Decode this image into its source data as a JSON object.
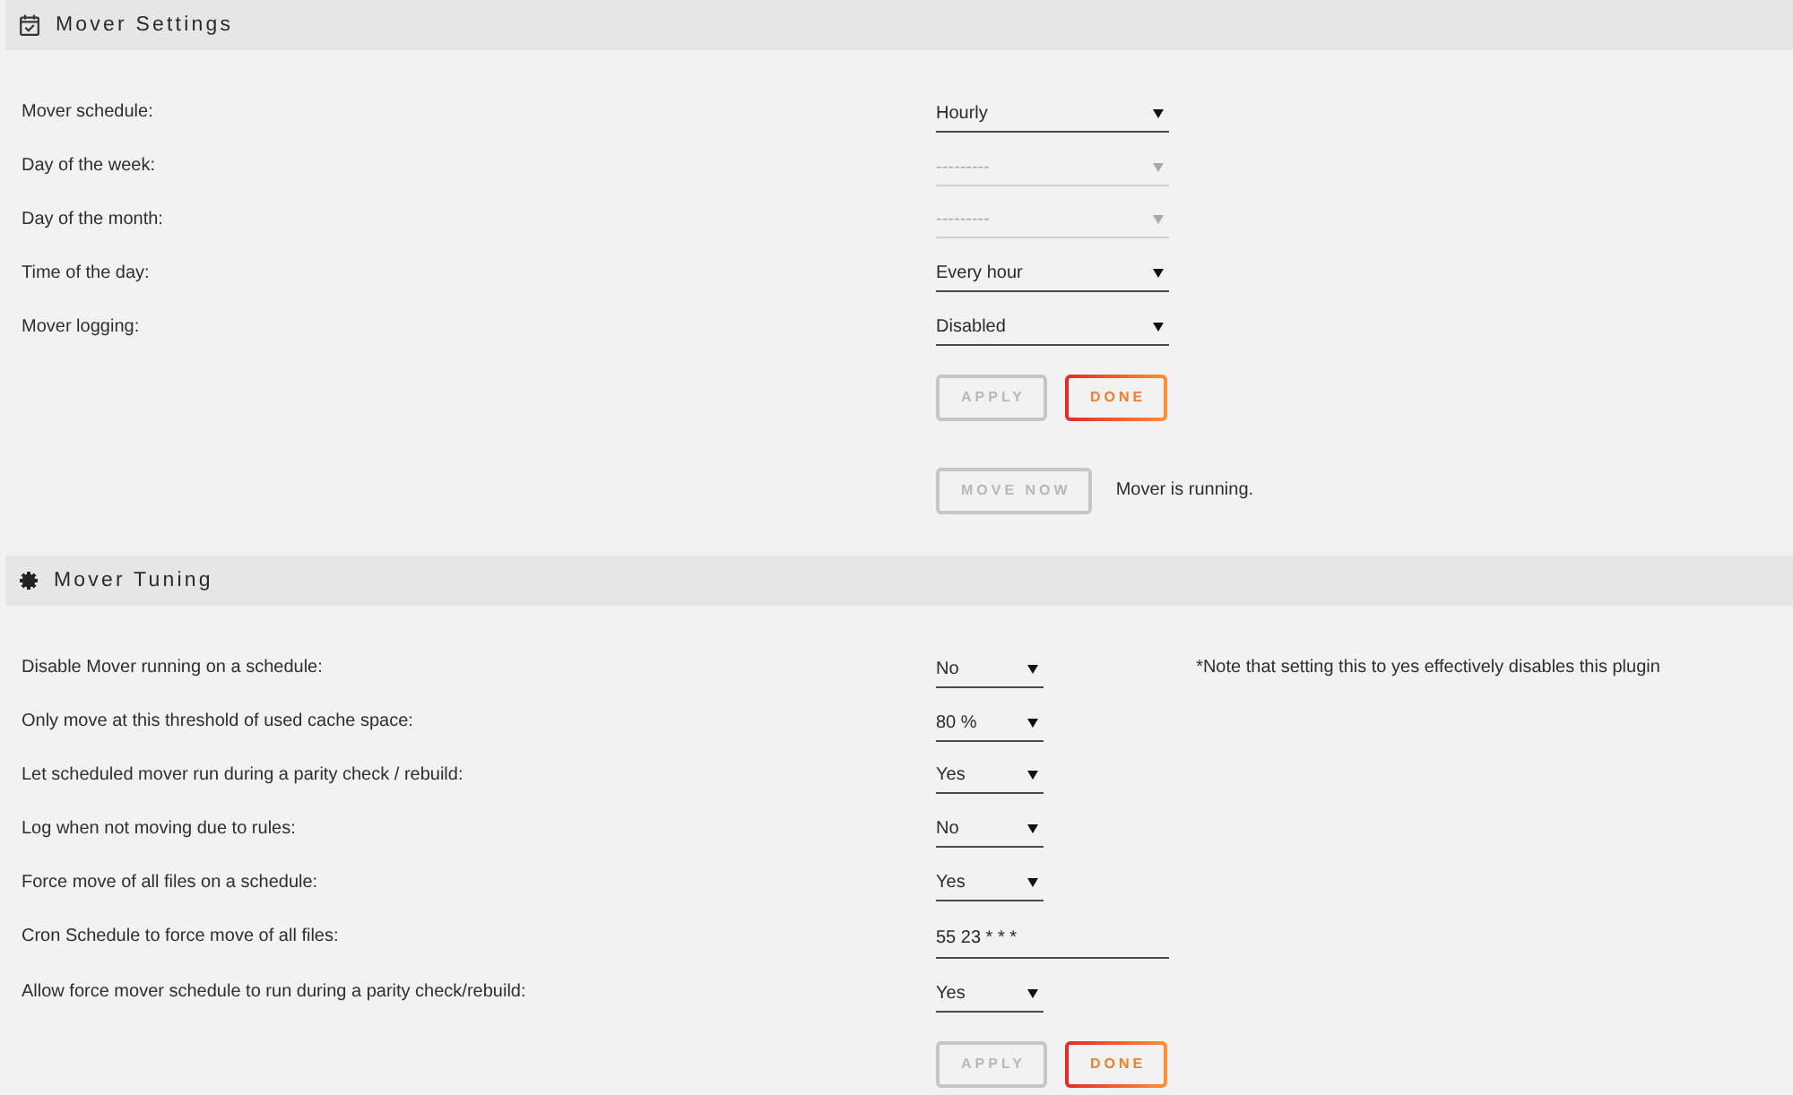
{
  "sections": [
    {
      "title": "Mover Settings",
      "rows": [
        {
          "kind": "select",
          "label": "Mover schedule:",
          "value": "Hourly",
          "disabled": false
        },
        {
          "kind": "select",
          "label": "Day of the week:",
          "value": "---------",
          "disabled": true
        },
        {
          "kind": "select",
          "label": "Day of the month:",
          "value": "---------",
          "disabled": true
        },
        {
          "kind": "select",
          "label": "Time of the day:",
          "value": "Every hour",
          "disabled": false
        },
        {
          "kind": "select",
          "label": "Mover logging:",
          "value": "Disabled",
          "disabled": false
        }
      ],
      "button_rows": [
        {
          "buttons": [
            {
              "label": "APPLY",
              "disabled": true
            },
            {
              "label": "DONE",
              "disabled": false
            }
          ]
        },
        {
          "buttons": [
            {
              "label": "MOVE NOW",
              "disabled": true
            }
          ],
          "status": "Mover is running."
        }
      ]
    },
    {
      "title": "Mover Tuning",
      "rows": [
        {
          "kind": "select",
          "label": "Disable Mover running on a schedule:",
          "value": "No",
          "disabled": false,
          "note": "*Note that setting this to yes effectively disables this plugin"
        },
        {
          "kind": "select",
          "label": "Only move at this threshold of used cache space:",
          "value": "80 %",
          "disabled": false
        },
        {
          "kind": "select",
          "label": "Let scheduled mover run during a parity check / rebuild:",
          "value": "Yes",
          "disabled": false
        },
        {
          "kind": "select",
          "label": "Log when not moving due to rules:",
          "value": "No",
          "disabled": false
        },
        {
          "kind": "select",
          "label": "Force move of all files on a schedule:",
          "value": "Yes",
          "disabled": false
        },
        {
          "kind": "text",
          "label": "Cron Schedule to force move of all files:",
          "value": "55 23 * * *",
          "disabled": false
        },
        {
          "kind": "select",
          "label": "Allow force mover schedule to run during a parity check/rebuild:",
          "value": "Yes",
          "disabled": false
        }
      ],
      "button_rows": [
        {
          "buttons": [
            {
              "label": "APPLY",
              "disabled": true
            },
            {
              "label": "DONE",
              "disabled": false
            }
          ]
        }
      ]
    }
  ]
}
